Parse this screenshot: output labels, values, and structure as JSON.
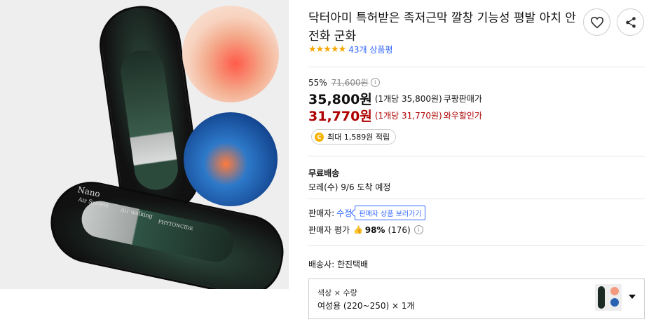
{
  "product": {
    "title": "닥터아미 특허받은 족저근막 깔창 기능성 평발 아치 안전화 군화",
    "stars": "★★★★★",
    "review_count": "43개 상품평",
    "rating_value": 5
  },
  "gallery": {
    "insole_text_1": "Nano",
    "insole_text_2": "Air System",
    "insole_text_3": "Air walking",
    "insole_text_4": "PHYTONCIDE"
  },
  "pricing": {
    "discount_rate": "55%",
    "original_price": "71,600원",
    "info_glyph": "i",
    "price": "35,800원",
    "unit_price": "(1개당 35,800원)",
    "price_label": "쿠팡판매가",
    "wow_price": "31,770원",
    "wow_unit_price": "(1개당 31,770원)",
    "wow_label": "와우할인가"
  },
  "points": {
    "coin": "C",
    "text": "최대 1,589원 적립"
  },
  "shipping": {
    "label": "무료배송",
    "arrival": "모레(수) 9/6 도착 예정"
  },
  "seller": {
    "label": "판매자:",
    "name": "수정",
    "store_button": "판매자 상품 보러가기",
    "rating_label": "판매자 평가",
    "rating_icon": "👍",
    "rating_pct": "98%",
    "rating_count": "(176)"
  },
  "courier": {
    "text": "배송사: 한진택배"
  },
  "option": {
    "header": "색상 × 수량",
    "value": "여성용 (220~250) × 1개"
  },
  "colors": {
    "accent": "#346aff",
    "wow": "#ae0000",
    "star": "#f6a700"
  }
}
